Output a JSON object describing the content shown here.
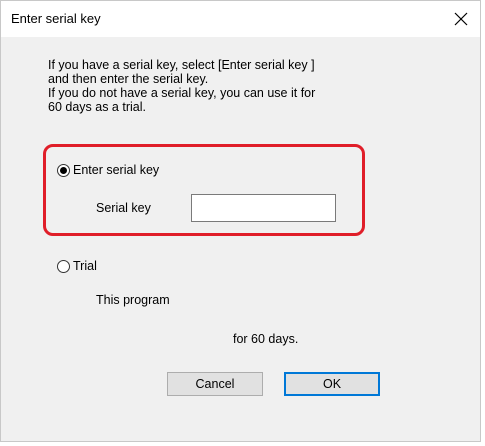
{
  "window": {
    "title": "Enter serial key"
  },
  "description": {
    "lines": [
      "If you have a serial key, select [Enter serial key ]",
      "and then enter the serial key.",
      "If you do not have  a serial key, you can use it for",
      "60 days as a trial."
    ]
  },
  "options": {
    "serial": {
      "label": "Enter serial key",
      "selected": true,
      "field_label": "Serial key",
      "field_value": ""
    },
    "trial": {
      "label": "Trial",
      "selected": false,
      "text_line1": "This program",
      "text_line2": "for 60 days."
    }
  },
  "buttons": {
    "cancel": "Cancel",
    "ok": "OK"
  },
  "colors": {
    "highlight": "#e01e29",
    "default_button_border": "#0078d7"
  }
}
